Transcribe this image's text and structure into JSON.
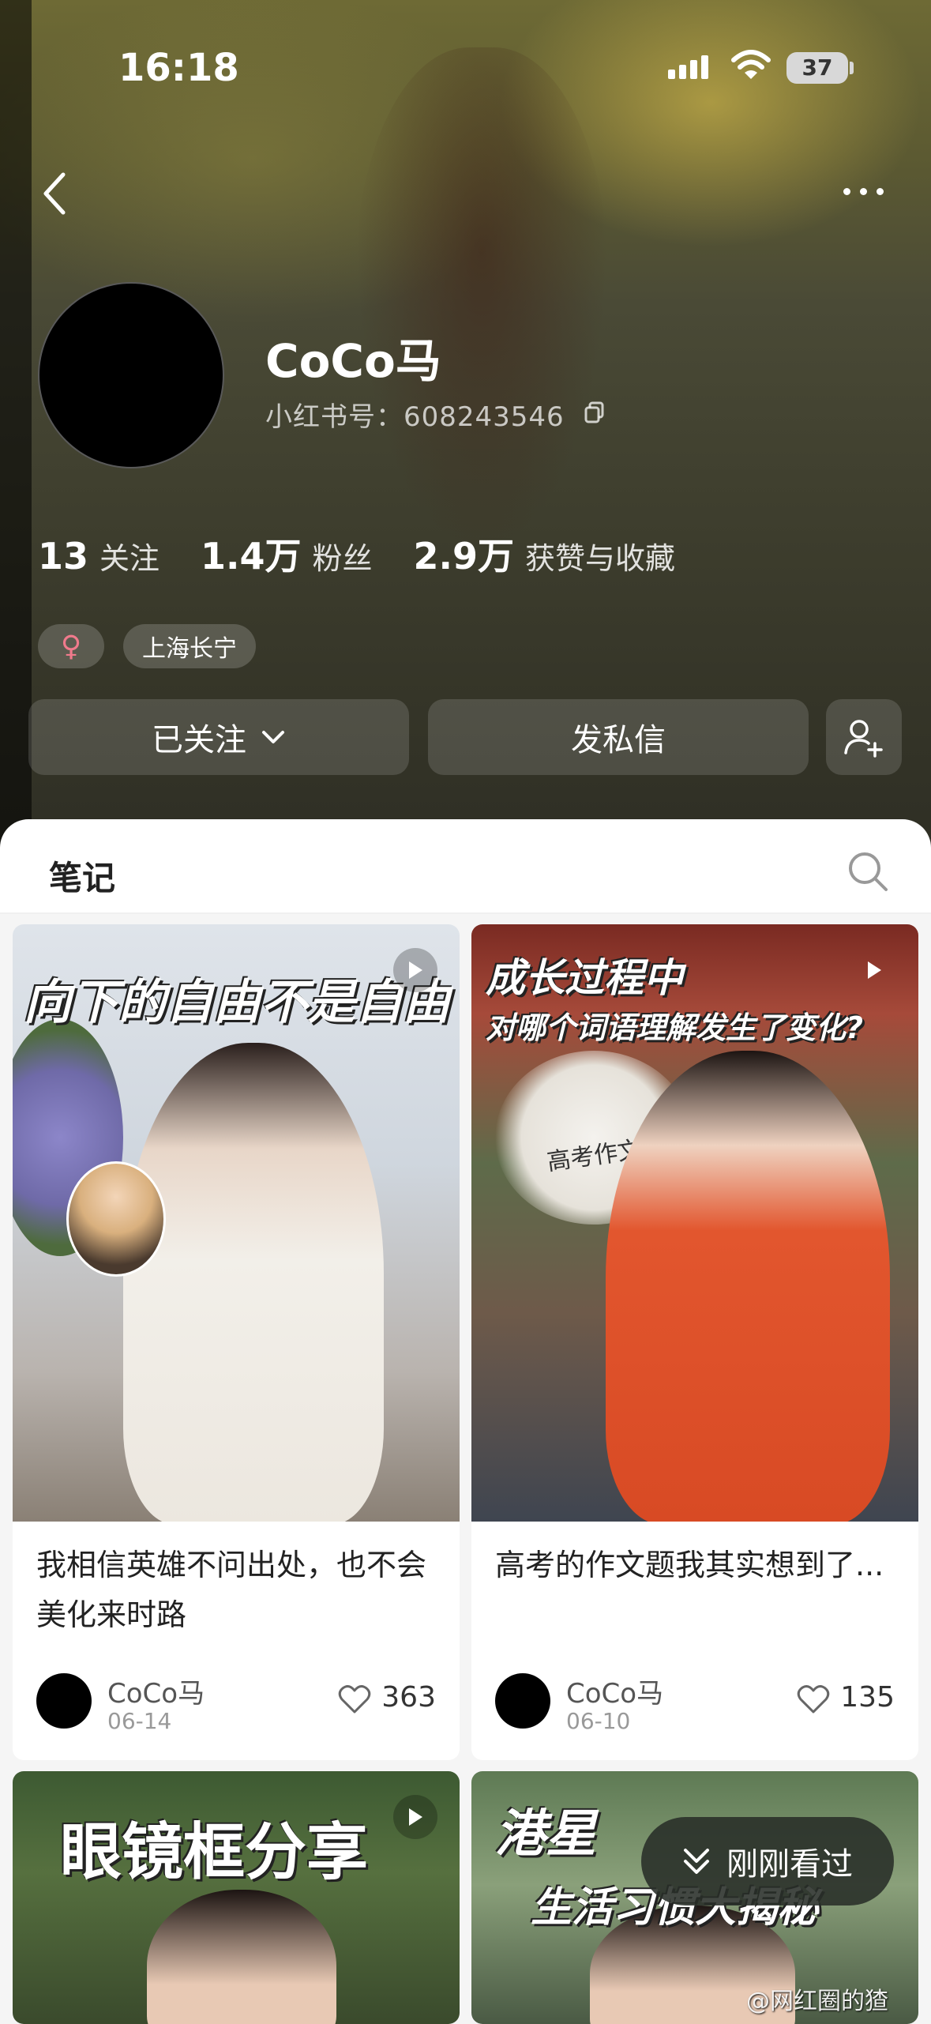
{
  "status_bar": {
    "time": "16:18",
    "battery": "37"
  },
  "profile": {
    "name": "CoCo马",
    "id_label": "小红书号：608243546",
    "stats": [
      {
        "value": "13",
        "label": "关注"
      },
      {
        "value": "1.4万",
        "label": "粉丝"
      },
      {
        "value": "2.9万",
        "label": "获赞与收藏"
      }
    ],
    "gender_symbol": "♀",
    "location": "上海长宁",
    "follow_button": "已关注",
    "message_button": "发私信"
  },
  "tabs": {
    "notes": "笔记"
  },
  "posts": [
    {
      "overlay": "向下的自由不是自由",
      "title": "我相信英雄不问出处，也不会美化来时路",
      "author": "CoCo马",
      "date": "06-14",
      "likes": "363"
    },
    {
      "overlay_line1": "成长过程中",
      "overlay_line2": "对哪个词语理解发生了变化?",
      "paper_text": "高考作文",
      "title": "高考的作文题我其实想到了...",
      "author": "CoCo马",
      "date": "06-10",
      "likes": "135"
    },
    {
      "overlay": "眼镜框分享"
    },
    {
      "overlay_line1": "港星",
      "overlay_line2": "生活习惯大揭秘"
    }
  ],
  "floating": {
    "recent_label": "刚刚看过"
  },
  "watermark": "@网红圈的猹",
  "colors": {
    "accent_tag": "#f07a8c",
    "panel": "#ffffff"
  }
}
